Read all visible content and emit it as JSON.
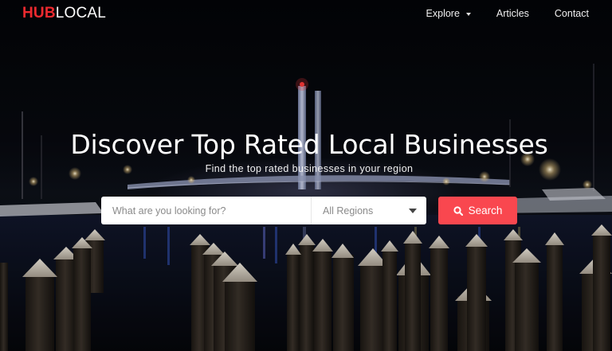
{
  "brand": {
    "part1": "HUB",
    "part2": "LOCAL",
    "accent_color": "#ee2a2f"
  },
  "nav": {
    "items": [
      {
        "label": "Explore",
        "has_dropdown": true
      },
      {
        "label": "Articles",
        "has_dropdown": false
      },
      {
        "label": "Contact",
        "has_dropdown": false
      }
    ]
  },
  "hero": {
    "headline": "Discover Top Rated Local Businesses",
    "subheadline": "Find the top rated businesses in your region",
    "background": "night harbor with lit pylons and bridge"
  },
  "search": {
    "placeholder": "What are you looking for?",
    "region_selected": "All Regions",
    "button_label": "Search",
    "button_icon": "search-icon",
    "button_color": "#f9474f"
  }
}
